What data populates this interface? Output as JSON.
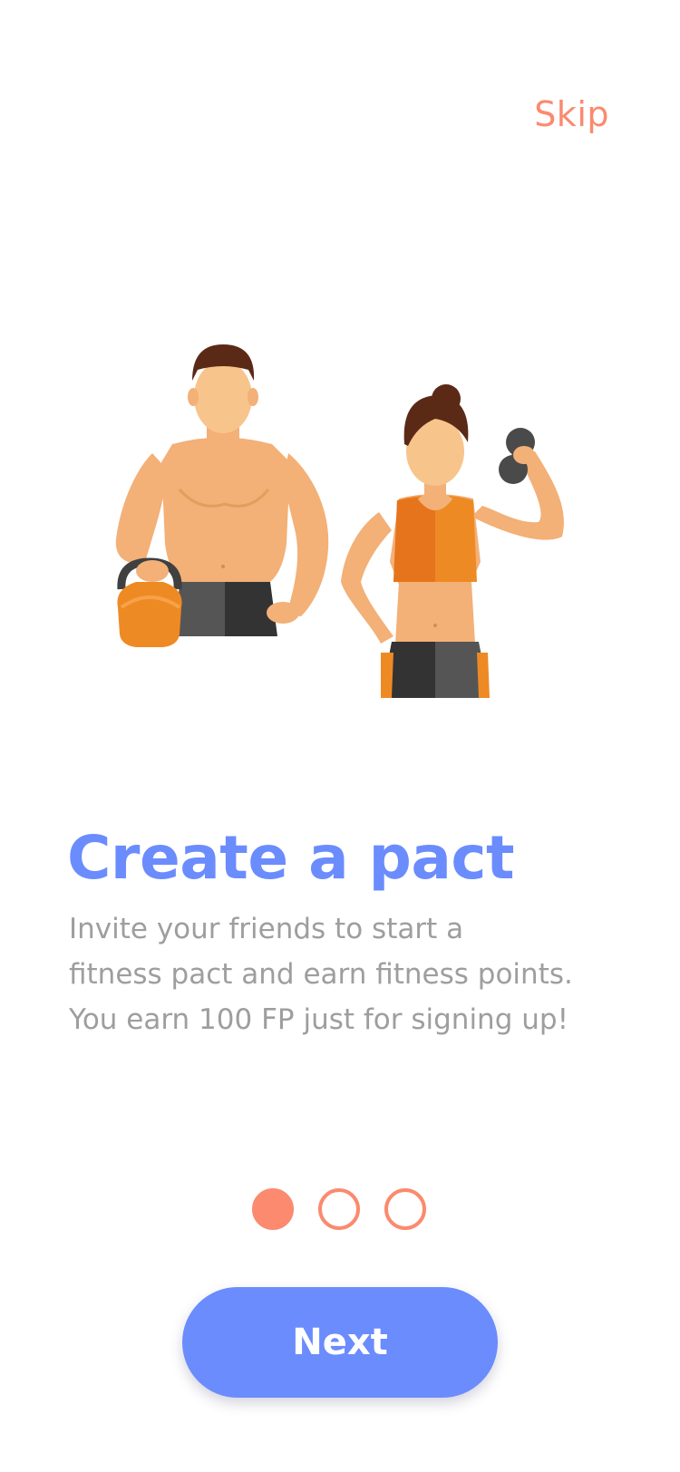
{
  "header": {
    "skip_label": "Skip"
  },
  "illustration": {
    "description_icon": "fitness-couple-illustration"
  },
  "content": {
    "title": "Create a pact",
    "body_lines": [
      "Invite your friends to start a",
      "fitness pact and earn fitness points.",
      "You earn 100 FP just for signing up!"
    ]
  },
  "pager": {
    "total": 3,
    "current": 1
  },
  "footer": {
    "next_label": "Next"
  },
  "colors": {
    "accent_blue": "#6b8cfd",
    "accent_coral": "#fb8a6e",
    "body_gray": "#9e9e9e",
    "background": "#ffffff"
  }
}
